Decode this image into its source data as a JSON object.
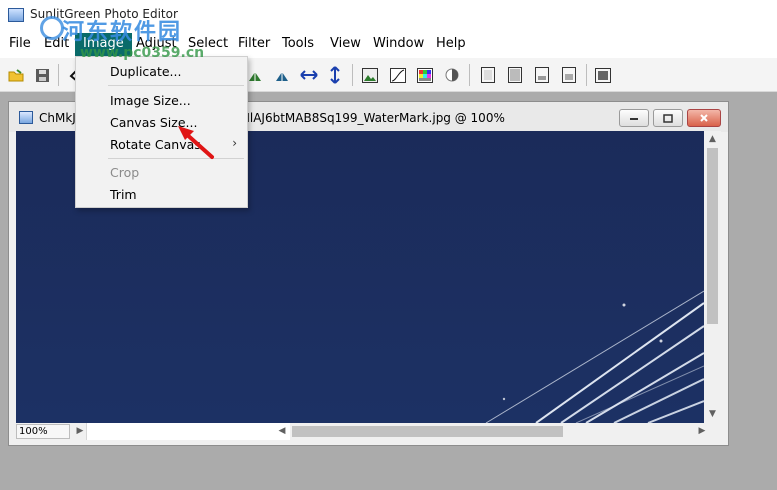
{
  "app": {
    "title": "SunlitGreen Photo Editor"
  },
  "watermark": {
    "text": "河东软件园",
    "url": "www.pc0359.cn"
  },
  "menubar": {
    "items": [
      {
        "label": "File",
        "active": false
      },
      {
        "label": "Edit",
        "active": false
      },
      {
        "label": "Image",
        "active": true
      },
      {
        "label": "Adjust",
        "active": false
      },
      {
        "label": "Select",
        "active": false
      },
      {
        "label": "Filter",
        "active": false
      },
      {
        "label": "Tools",
        "active": false
      },
      {
        "label": "View",
        "active": false
      },
      {
        "label": "Window",
        "active": false
      },
      {
        "label": "Help",
        "active": false
      }
    ]
  },
  "toolbar": {
    "icons": [
      "open-folder-icon",
      "save-icon",
      "undo-icon",
      "flip-left-icon",
      "flip-right-icon",
      "flip-horizontal-icon",
      "flip-vertical-icon",
      "landscape-image-icon",
      "curves-icon",
      "color-balance-icon",
      "contrast-icon",
      "frame-icon",
      "frame-shadow-icon",
      "document-icon",
      "document-alt-icon",
      "fullscreen-icon"
    ]
  },
  "image_menu": {
    "items": [
      {
        "label": "Duplicate...",
        "disabled": false
      },
      {
        "label": "Image Size...",
        "disabled": false
      },
      {
        "label": "Canvas Size...",
        "disabled": false
      },
      {
        "label": "Rotate Canvas",
        "disabled": false,
        "submenu": "›"
      },
      {
        "label": "Crop",
        "disabled": true
      },
      {
        "label": "Trim",
        "disabled": false
      }
    ]
  },
  "document": {
    "title": "ChMkJ",
    "title_suffix": "TIlAJ6btMAB8Sq199_WaterMark.jpg @ 100%",
    "zoom": "100%",
    "colors": {
      "sky": "#1a2e5c",
      "lines": "#e8eef8"
    }
  }
}
